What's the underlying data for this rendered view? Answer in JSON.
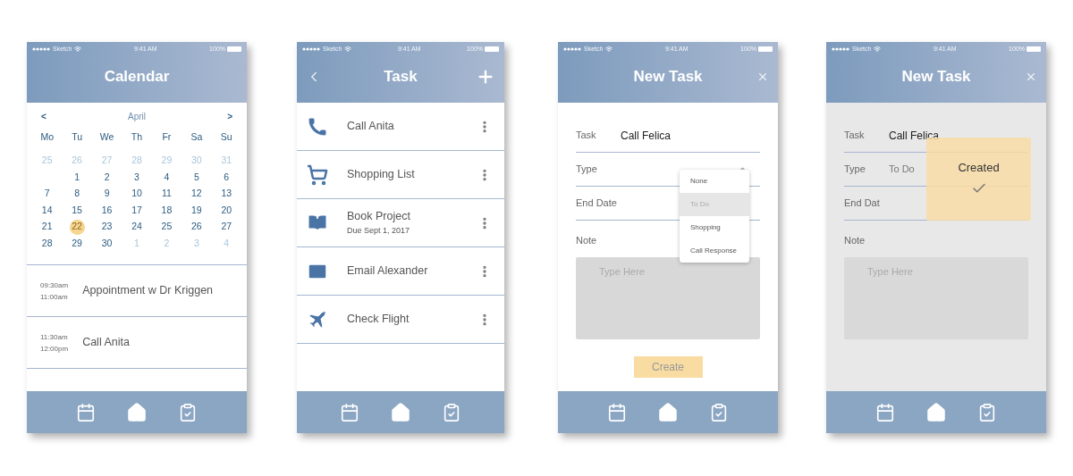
{
  "screens": [
    {
      "kind": "calendar",
      "status": {
        "carrier": "Sketch",
        "time": "9:41 AM",
        "battery": "100%"
      },
      "title": "Calendar",
      "month": "April",
      "prev": "<",
      "next": ">",
      "weekdays": [
        "Mo",
        "Tu",
        "We",
        "Th",
        "Fr",
        "Sa",
        "Su"
      ],
      "weeks": [
        [
          {
            "d": "25",
            "muted": true,
            "selected": false
          },
          {
            "d": "26",
            "muted": true,
            "selected": false
          },
          {
            "d": "27",
            "muted": true,
            "selected": false
          },
          {
            "d": "28",
            "muted": true,
            "selected": false
          },
          {
            "d": "29",
            "muted": true,
            "selected": false
          },
          {
            "d": "30",
            "muted": true,
            "selected": false
          },
          {
            "d": "31",
            "muted": true,
            "selected": false
          }
        ],
        [
          {
            "d": "1",
            "muted": false,
            "selected": false
          },
          {
            "d": "2",
            "muted": false,
            "selected": false
          },
          {
            "d": "3",
            "muted": false,
            "selected": false
          },
          {
            "d": "4",
            "muted": false,
            "selected": false
          },
          {
            "d": "5",
            "muted": false,
            "selected": false
          },
          {
            "d": "6",
            "muted": false,
            "selected": false
          }
        ],
        [
          {
            "d": "7",
            "muted": false,
            "selected": false
          },
          {
            "d": "8",
            "muted": false,
            "selected": false
          },
          {
            "d": "9",
            "muted": false,
            "selected": false
          },
          {
            "d": "10",
            "muted": false,
            "selected": false
          },
          {
            "d": "11",
            "muted": false,
            "selected": false
          },
          {
            "d": "12",
            "muted": false,
            "selected": false
          },
          {
            "d": "13",
            "muted": false,
            "selected": false
          }
        ],
        [
          {
            "d": "14",
            "muted": false,
            "selected": false
          },
          {
            "d": "15",
            "muted": false,
            "selected": false
          },
          {
            "d": "16",
            "muted": false,
            "selected": false
          },
          {
            "d": "17",
            "muted": false,
            "selected": false
          },
          {
            "d": "18",
            "muted": false,
            "selected": false
          },
          {
            "d": "19",
            "muted": false,
            "selected": false
          },
          {
            "d": "20",
            "muted": false,
            "selected": false
          }
        ],
        [
          {
            "d": "21",
            "muted": false,
            "selected": false
          },
          {
            "d": "22",
            "muted": false,
            "selected": true
          },
          {
            "d": "23",
            "muted": false,
            "selected": false
          },
          {
            "d": "24",
            "muted": false,
            "selected": false
          },
          {
            "d": "25",
            "muted": false,
            "selected": false
          },
          {
            "d": "26",
            "muted": false,
            "selected": false
          },
          {
            "d": "27",
            "muted": false,
            "selected": false
          }
        ],
        [
          {
            "d": "28",
            "muted": false,
            "selected": false
          },
          {
            "d": "29",
            "muted": false,
            "selected": false
          },
          {
            "d": "30",
            "muted": false,
            "selected": false
          },
          {
            "d": "1",
            "muted": true,
            "selected": false
          },
          {
            "d": "2",
            "muted": true,
            "selected": false
          },
          {
            "d": "3",
            "muted": true,
            "selected": false
          },
          {
            "d": "4",
            "muted": true,
            "selected": false
          }
        ]
      ],
      "events": [
        {
          "start": "09:30am",
          "end": "11:00am",
          "title": "Appointment w Dr Kriggen"
        },
        {
          "start": "11:30am",
          "end": "12:00pm",
          "title": "Call Anita"
        }
      ]
    },
    {
      "kind": "list",
      "status": {
        "carrier": "Sketch",
        "time": "9:41 AM",
        "battery": "100%"
      },
      "title": "Task",
      "items": [
        {
          "title": "Call Anita"
        },
        {
          "title": "Shopping List"
        },
        {
          "title": "Book Project",
          "subtitle": "Due Sept 1, 2017"
        },
        {
          "title": "Email Alexander"
        },
        {
          "title": "Check Flight"
        }
      ]
    },
    {
      "kind": "form",
      "status": {
        "carrier": "Sketch",
        "time": "9:41 AM",
        "battery": "100%"
      },
      "title": "New Task",
      "fields": [
        {
          "label": "Task",
          "value": "Call Felica"
        },
        {
          "label": "Type",
          "expanded": true
        },
        {
          "label": "End Date"
        }
      ],
      "note_label": "Note",
      "note_placeholder": "Type Here",
      "button": "Create",
      "dropdown": [
        {
          "label": "None",
          "selected": false
        },
        {
          "label": "To Do",
          "selected": true
        },
        {
          "label": "Shopping",
          "selected": false
        },
        {
          "label": "Call Response",
          "selected": false
        }
      ]
    },
    {
      "kind": "done",
      "status": {
        "carrier": "Sketch",
        "time": "9:41 AM",
        "battery": "100%"
      },
      "title": "New Task",
      "fields": [
        {
          "label": "Task",
          "value": "Call Felica"
        },
        {
          "label": "Type",
          "value": "To Do"
        },
        {
          "label": "End Dat"
        }
      ],
      "note_label": "Note",
      "note_placeholder": "Type Here",
      "toast": "Created"
    }
  ]
}
